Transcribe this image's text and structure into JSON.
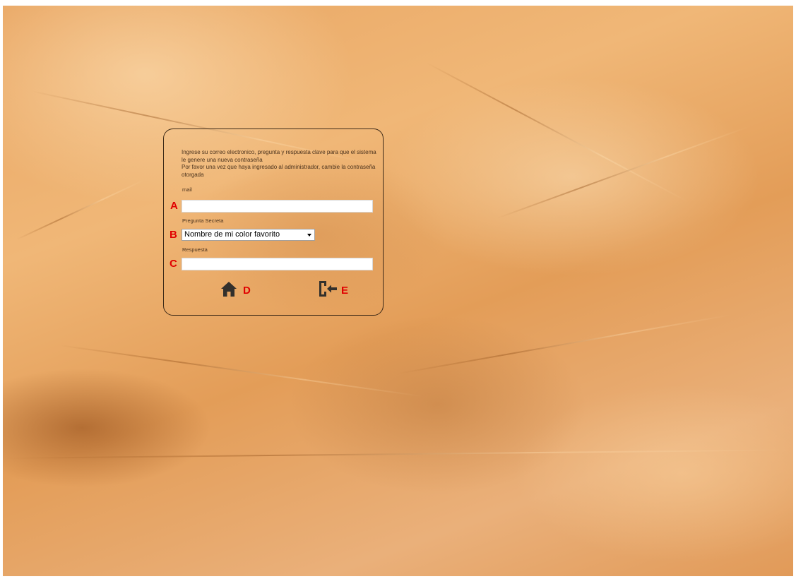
{
  "form": {
    "instructions": [
      "Ingrese su correo electronico, pregunta y respuesta clave para que el sistema le genere una nueva contraseña",
      "Por favor una vez que haya ingresado al administrador, cambie la contraseña otorgada"
    ],
    "email_label": "mail",
    "email_value": "",
    "question_label": "Pregunta Secreta",
    "question_selected": "Nombre de mi color favorito",
    "answer_label": "Respuesta",
    "answer_value": ""
  },
  "markers": {
    "a": "A",
    "b": "B",
    "c": "C",
    "d": "D",
    "e": "E"
  },
  "icons": {
    "home": "home-icon",
    "exit": "sign-out-icon"
  },
  "colors": {
    "marker": "#e00000",
    "panel_border": "#3d2a18",
    "icon": "#33302c"
  }
}
